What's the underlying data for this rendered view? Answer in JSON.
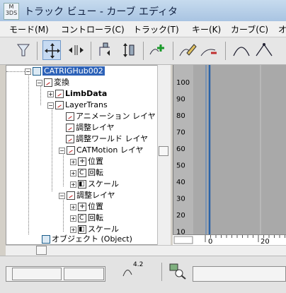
{
  "window": {
    "title": "トラック ビュー - カーブ エディタ",
    "app_icon_text": "3DS"
  },
  "menu": [
    {
      "label": "モード(M)"
    },
    {
      "label": "コントローラ(C)"
    },
    {
      "label": "トラック(T)"
    },
    {
      "label": "キー(K)"
    },
    {
      "label": "カーブ(C)"
    },
    {
      "label": "オ"
    }
  ],
  "toolbar": {
    "buttons": [
      "filter-icon",
      "move-keys-icon",
      "slide-keys-icon",
      "scale-keys-icon",
      "scale-values-icon",
      "add-keys-icon",
      "draw-curves-icon",
      "reduce-keys-icon",
      "custom-tangent-icon",
      "fast-tangent-icon"
    ],
    "active_index": 1
  },
  "tree": {
    "rows": [
      {
        "label": "CATRIGHub002"
      },
      {
        "label": "変換"
      },
      {
        "label": "LimbData"
      },
      {
        "label": "LayerTrans"
      },
      {
        "label": "アニメーション レイヤ"
      },
      {
        "label": "調整レイヤ"
      },
      {
        "label": "調整ワールド レイヤ"
      },
      {
        "label": "CATMotion レイヤ"
      },
      {
        "label": "位置"
      },
      {
        "label": "回転"
      },
      {
        "label": "スケール"
      },
      {
        "label": "調整レイヤ"
      },
      {
        "label": "位置"
      },
      {
        "label": "回転"
      },
      {
        "label": "スケール"
      },
      {
        "label": "オブジェクト (Object)"
      }
    ]
  },
  "graph": {
    "y_labels": [
      "100",
      "90",
      "80",
      "70",
      "60",
      "50",
      "40",
      "30",
      "20",
      "10"
    ],
    "ruler_labels": [
      "0",
      "20"
    ]
  },
  "status": {
    "zoom_label": "4.2"
  },
  "colors": {
    "selection": "#2d62b8",
    "graph_bg": "#a9a9a9",
    "time_slider": "#2a63a8"
  }
}
